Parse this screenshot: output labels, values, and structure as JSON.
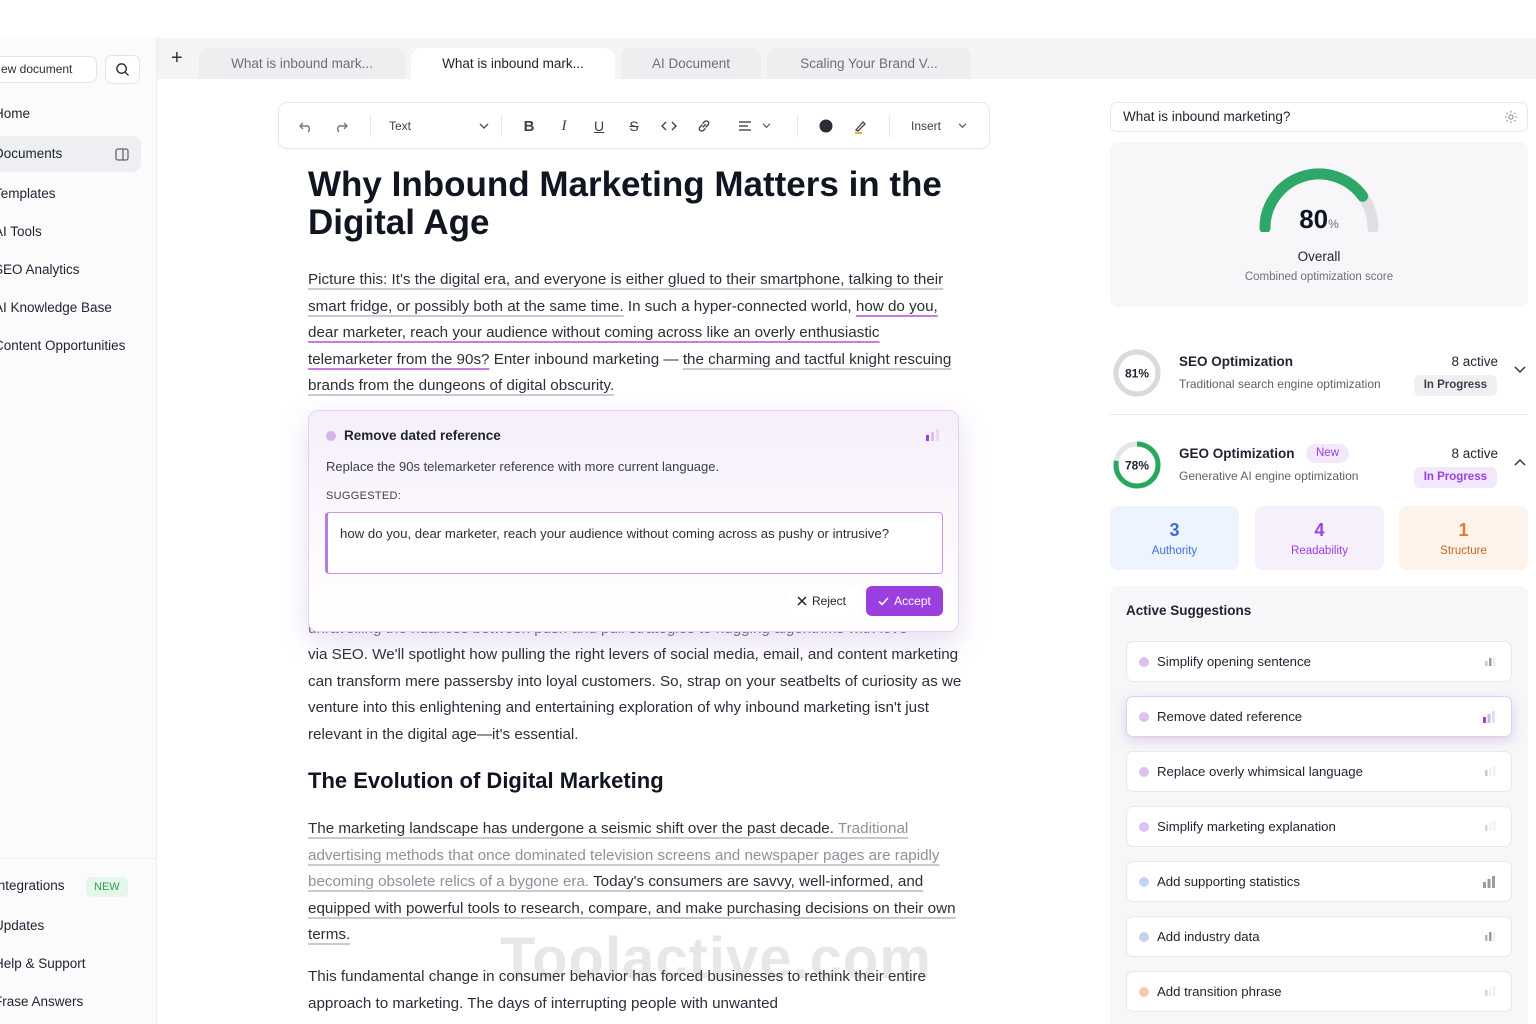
{
  "sidebar": {
    "new_document": "ew document",
    "items": [
      {
        "label": "Home"
      },
      {
        "label": "Documents"
      },
      {
        "label": "Templates"
      },
      {
        "label": "AI Tools"
      },
      {
        "label": "SEO Analytics"
      },
      {
        "label": "AI Knowledge Base"
      },
      {
        "label": "Content Opportunities"
      }
    ],
    "bottom_items": [
      {
        "label": "Integrations",
        "badge": "NEW"
      },
      {
        "label": "Updates"
      },
      {
        "label": "Help & Support"
      },
      {
        "label": "Frase Answers"
      }
    ]
  },
  "tabs": [
    {
      "label": "What is inbound mark..."
    },
    {
      "label": "What is inbound mark..."
    },
    {
      "label": "AI Document"
    },
    {
      "label": "Scaling Your Brand V..."
    }
  ],
  "toolbar": {
    "text_style": "Text",
    "insert": "Insert"
  },
  "document": {
    "title": "Why Inbound Marketing Matters in the Digital Age",
    "p1_a": "Picture this: It's the digital era, and everyone is either glued to their smartphone, talking to their smart fridge, or possibly both at the same time.",
    "p1_b": " In such a hyper-connected world, ",
    "p1_c": "how do you, dear marketer, reach your audience without coming across like an overly enthusiastic telemarketer from the 90s?",
    "p1_d": " Enter inbound marketing — ",
    "p1_e": "the charming and tactful knight rescuing brands from the dungeons of digital obscurity.",
    "p2_hidden": "unravelling the nuances between push and pull strategies to hugging algorithms with love",
    "p2": "via SEO. We'll spotlight how pulling the right levers of social media, email, and content marketing can transform mere passersby into loyal customers. So, strap on your seatbelts of curiosity as we venture into this enlightening and entertaining exploration of why inbound marketing isn't just relevant in the digital age—it's essential.",
    "h2": "The Evolution of Digital Marketing",
    "p3_a": "The marketing landscape has undergone a seismic shift over the past decade.",
    "p3_b": " Traditional advertising methods that once dominated television screens and newspaper pages are rapidly becoming obsolete relics of a bygone era.",
    "p3_c": " Today's consumers are savvy, well-informed, and equipped with powerful tools to research, compare, and make purchasing decisions on their own terms.",
    "p4": "This fundamental change in consumer behavior has forced businesses to rethink their entire approach to marketing. The days of interrupting people with unwanted"
  },
  "popup": {
    "title": "Remove dated reference",
    "description": "Replace the 90s telemarketer reference with more current language.",
    "suggested_label": "SUGGESTED:",
    "suggested_text": "how do you, dear marketer, reach your audience without coming across as pushy or intrusive?",
    "reject": "Reject",
    "accept": "Accept"
  },
  "panel": {
    "keyword": "What is inbound marketing?",
    "overall_score": "80",
    "overall_unit": "%",
    "overall_fraction": 0.8,
    "overall_label": "Overall",
    "overall_sub": "Combined optimization score",
    "seo": {
      "percent": "81%",
      "fraction": 0.81,
      "name": "SEO Optimization",
      "desc": "Traditional search engine optimization",
      "active": "8 active",
      "status": "In Progress"
    },
    "geo": {
      "percent": "78%",
      "fraction": 0.78,
      "name": "GEO Optimization",
      "tag": "New",
      "desc": "Generative AI engine optimization",
      "active": "8 active",
      "status": "In Progress"
    },
    "stats": [
      {
        "value": "3",
        "label": "Authority"
      },
      {
        "value": "4",
        "label": "Readability"
      },
      {
        "value": "1",
        "label": "Structure"
      }
    ],
    "suggestions_head": "Active Suggestions",
    "suggestions": [
      {
        "label": "Simplify opening sentence"
      },
      {
        "label": "Remove dated reference"
      },
      {
        "label": "Replace overly whimsical language"
      },
      {
        "label": "Simplify marketing explanation"
      },
      {
        "label": "Add supporting statistics"
      },
      {
        "label": "Add industry data"
      },
      {
        "label": "Add transition phrase"
      }
    ],
    "colors": {
      "purple": "#9b3fe0",
      "green": "#27a85a",
      "blue": "#3f6fd6",
      "orange": "#e07a2e"
    }
  },
  "watermark": "Toolactive.com"
}
